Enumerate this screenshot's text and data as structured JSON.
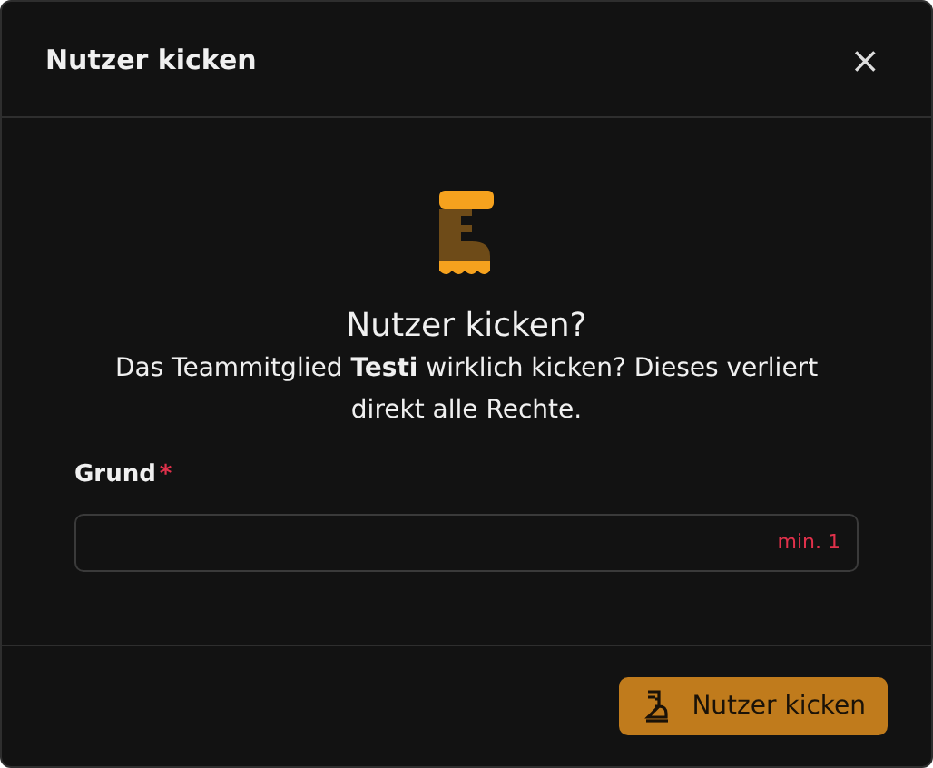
{
  "dialog": {
    "title": "Nutzer kicken",
    "close": "×"
  },
  "body": {
    "heading": "Nutzer kicken?",
    "message": "Das Teammitglied **Testi** wirklich kicken? Dieses verliert direkt alle Rechte."
  },
  "field": {
    "label": "Grund",
    "required_mark": "*",
    "hint": "min. 1"
  },
  "buttons": [
    {
      "label": "Nutzer kicken",
      "kind": "primary"
    }
  ]
}
